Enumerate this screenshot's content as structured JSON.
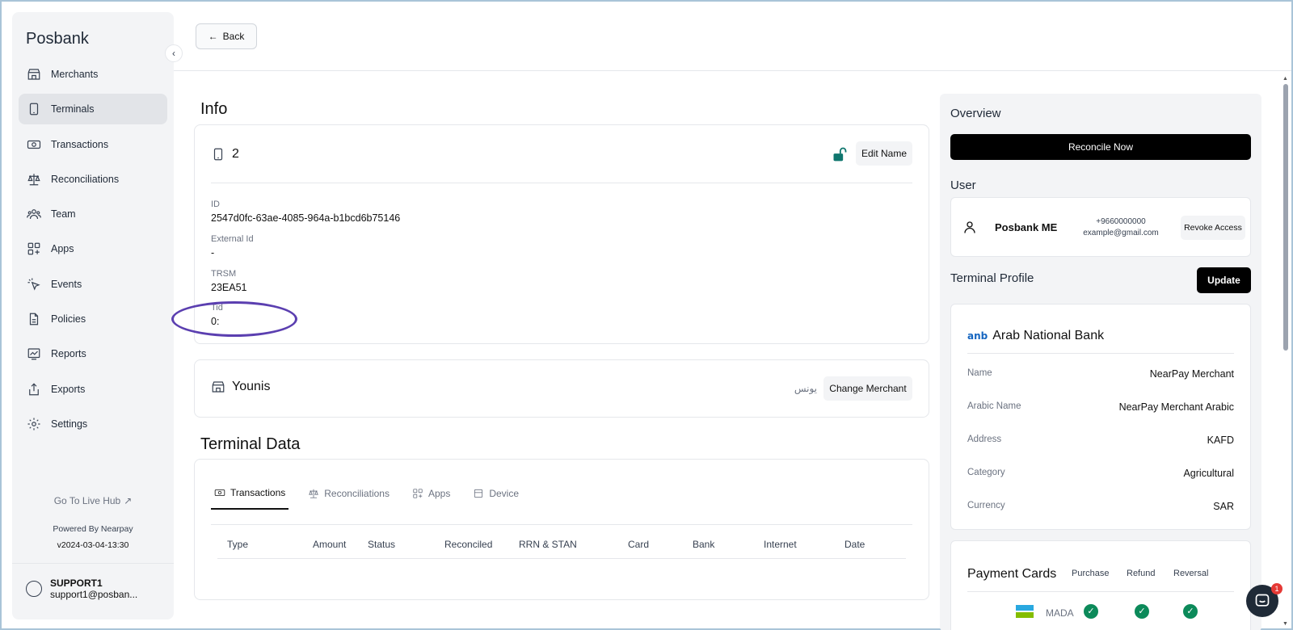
{
  "sidebar": {
    "brand": "Posbank",
    "items": [
      {
        "label": "Merchants",
        "icon": "store-icon"
      },
      {
        "label": "Terminals",
        "icon": "tablet-icon",
        "active": true
      },
      {
        "label": "Transactions",
        "icon": "banknote-icon"
      },
      {
        "label": "Reconciliations",
        "icon": "scale-icon"
      },
      {
        "label": "Team",
        "icon": "users-icon"
      },
      {
        "label": "Apps",
        "icon": "apps-grid-icon"
      },
      {
        "label": "Events",
        "icon": "pointer-click-icon"
      },
      {
        "label": "Policies",
        "icon": "file-icon"
      },
      {
        "label": "Reports",
        "icon": "chart-icon"
      },
      {
        "label": "Exports",
        "icon": "share-icon"
      },
      {
        "label": "Settings",
        "icon": "gear-icon"
      }
    ],
    "go_live": "Go To Live Hub",
    "powered": "Powered By Nearpay",
    "version": "v2024-03-04-13:30",
    "user": {
      "name": "SUPPORT1",
      "email": "support1@posban..."
    }
  },
  "topbar": {
    "back_label": "Back"
  },
  "info": {
    "title": "Info",
    "terminal_name": "2",
    "edit_label": "Edit Name",
    "fields": [
      {
        "label": "ID",
        "value": "2547d0fc-63ae-4085-964a-b1bcd6b75146"
      },
      {
        "label": "External Id",
        "value": "-"
      },
      {
        "label": "TRSM",
        "value": "23EA51"
      },
      {
        "label": "Tid",
        "value": "0:"
      }
    ]
  },
  "merchant": {
    "name": "Younis",
    "arabic_name": "يونس",
    "change_label": "Change Merchant"
  },
  "terminal_data": {
    "title": "Terminal Data",
    "tabs": [
      "Transactions",
      "Reconciliations",
      "Apps",
      "Device"
    ],
    "columns": [
      "Type",
      "Amount",
      "Status",
      "Reconciled",
      "RRN & STAN",
      "Card",
      "Bank",
      "Internet",
      "Date"
    ]
  },
  "overview": {
    "title": "Overview",
    "reconcile_label": "Reconcile Now",
    "user_title": "User",
    "user": {
      "name": "Posbank ME",
      "phone": "+9660000000",
      "email": "example@gmail.com"
    },
    "revoke_label": "Revoke Access",
    "profile_title": "Terminal Profile",
    "update_label": "Update",
    "bank_logo": "anb",
    "bank_name": "Arab National Bank",
    "profile_rows": [
      {
        "label": "Name",
        "value": "NearPay Merchant"
      },
      {
        "label": "Arabic Name",
        "value": "NearPay Merchant Arabic"
      },
      {
        "label": "Address",
        "value": "KAFD"
      },
      {
        "label": "Category",
        "value": "Agricultural"
      },
      {
        "label": "Currency",
        "value": "SAR"
      }
    ],
    "payment": {
      "title": "Payment Cards",
      "columns": [
        "Purchase",
        "Refund",
        "Reversal"
      ],
      "card": "MADA"
    }
  },
  "chat": {
    "badge": "1"
  },
  "colors": {
    "accent_green": "#0c8a5a",
    "oval": "#5b3fb0",
    "lock": "#0f766e"
  }
}
